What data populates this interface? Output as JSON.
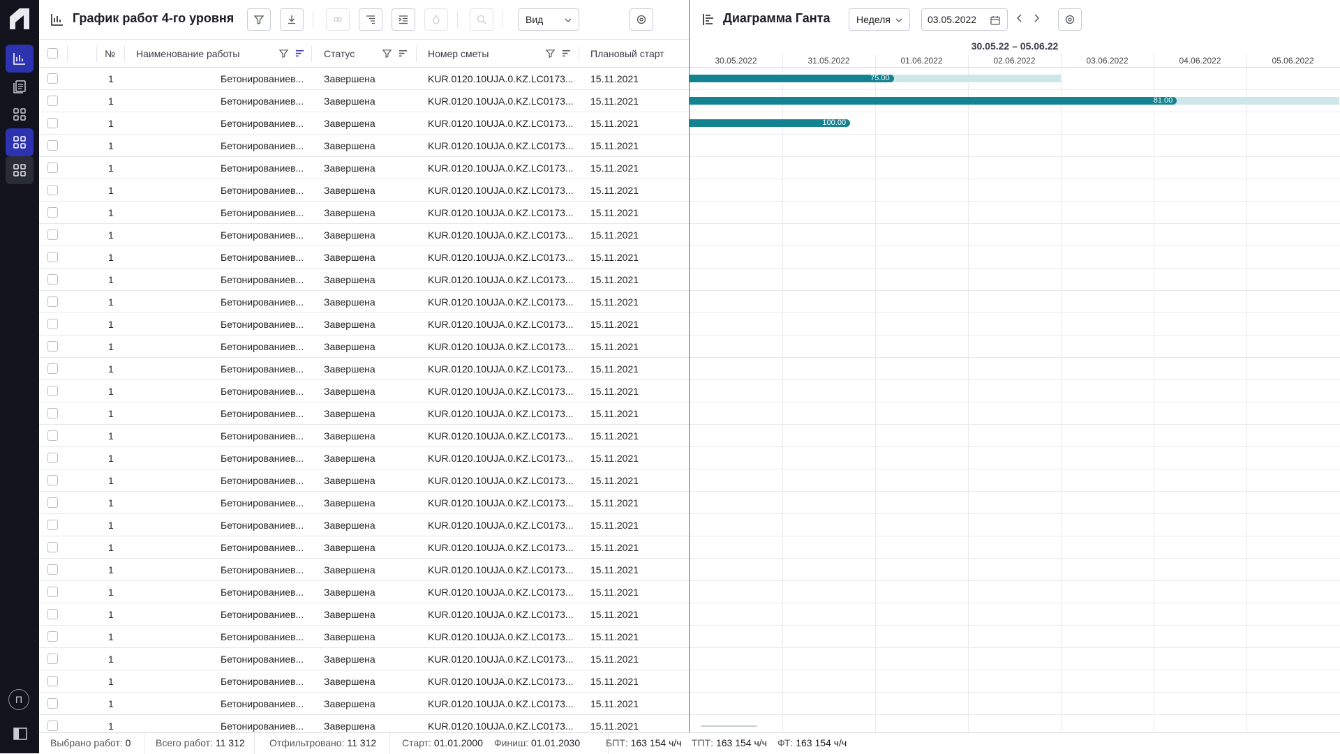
{
  "nav": {
    "items": [
      {
        "icon": "chart-icon",
        "state": "active"
      },
      {
        "icon": "documents-icon",
        "state": "normal"
      },
      {
        "icon": "grid-icon",
        "state": "normal"
      },
      {
        "icon": "grid-icon",
        "state": "active"
      },
      {
        "icon": "grid-icon",
        "state": "hover"
      }
    ],
    "user_initial": "П"
  },
  "left": {
    "title": "График работ 4-го уровня",
    "view_label": "Вид",
    "toolbar_icons": [
      "filter-icon",
      "download-icon",
      "link-icon",
      "indent-icon",
      "expand-icon",
      "fill-icon",
      "search-icon",
      "settings-icon"
    ],
    "columns": {
      "no": "№",
      "name": "Наименование работы",
      "status": "Статус",
      "smeta": "Номер сметы",
      "start": "Плановый старт"
    },
    "row_template": {
      "no": "1",
      "name": "Бетонированиев...",
      "status": "Завершена",
      "smeta": "KUR.0120.10UJA.0.KZ.LC0173...",
      "start": "15.11.2021"
    },
    "rows": [
      {
        "no": "1",
        "name": "Бетонированиев...",
        "status": "Завершена",
        "smeta": "KUR.0120.10UJA.0.KZ.LC0173...",
        "start": "15.11.2021"
      },
      {
        "no": "1",
        "name": "Бетонированиев...",
        "status": "Завершена",
        "smeta": "KUR.0120.10UJA.0.KZ.LC0173...",
        "start": "15.11.2021"
      },
      {
        "no": "1",
        "name": "Бетонированиев...",
        "status": "Завершена",
        "smeta": "KUR.0120.10UJA.0.KZ.LC0173...",
        "start": "15.11.2021"
      },
      {
        "no": "1",
        "name": "Бетонированиев...",
        "status": "Завершена",
        "smeta": "KUR.0120.10UJA.0.KZ.LC0173...",
        "start": "15.11.2021"
      },
      {
        "no": "1",
        "name": "Бетонированиев...",
        "status": "Завершена",
        "smeta": "KUR.0120.10UJA.0.KZ.LC0173...",
        "start": "15.11.2021"
      },
      {
        "no": "1",
        "name": "Бетонированиев...",
        "status": "Завершена",
        "smeta": "KUR.0120.10UJA.0.KZ.LC0173...",
        "start": "15.11.2021"
      },
      {
        "no": "1",
        "name": "Бетонированиев...",
        "status": "Завершена",
        "smeta": "KUR.0120.10UJA.0.KZ.LC0173...",
        "start": "15.11.2021"
      },
      {
        "no": "1",
        "name": "Бетонированиев...",
        "status": "Завершена",
        "smeta": "KUR.0120.10UJA.0.KZ.LC0173...",
        "start": "15.11.2021"
      },
      {
        "no": "1",
        "name": "Бетонированиев...",
        "status": "Завершена",
        "smeta": "KUR.0120.10UJA.0.KZ.LC0173...",
        "start": "15.11.2021"
      },
      {
        "no": "1",
        "name": "Бетонированиев...",
        "status": "Завершена",
        "smeta": "KUR.0120.10UJA.0.KZ.LC0173...",
        "start": "15.11.2021"
      },
      {
        "no": "1",
        "name": "Бетонированиев...",
        "status": "Завершена",
        "smeta": "KUR.0120.10UJA.0.KZ.LC0173...",
        "start": "15.11.2021"
      },
      {
        "no": "1",
        "name": "Бетонированиев...",
        "status": "Завершена",
        "smeta": "KUR.0120.10UJA.0.KZ.LC0173...",
        "start": "15.11.2021"
      },
      {
        "no": "1",
        "name": "Бетонированиев...",
        "status": "Завершена",
        "smeta": "KUR.0120.10UJA.0.KZ.LC0173...",
        "start": "15.11.2021"
      },
      {
        "no": "1",
        "name": "Бетонированиев...",
        "status": "Завершена",
        "smeta": "KUR.0120.10UJA.0.KZ.LC0173...",
        "start": "15.11.2021"
      },
      {
        "no": "1",
        "name": "Бетонированиев...",
        "status": "Завершена",
        "smeta": "KUR.0120.10UJA.0.KZ.LC0173...",
        "start": "15.11.2021"
      },
      {
        "no": "1",
        "name": "Бетонированиев...",
        "status": "Завершена",
        "smeta": "KUR.0120.10UJA.0.KZ.LC0173...",
        "start": "15.11.2021"
      },
      {
        "no": "1",
        "name": "Бетонированиев...",
        "status": "Завершена",
        "smeta": "KUR.0120.10UJA.0.KZ.LC0173...",
        "start": "15.11.2021"
      },
      {
        "no": "1",
        "name": "Бетонированиев...",
        "status": "Завершена",
        "smeta": "KUR.0120.10UJA.0.KZ.LC0173...",
        "start": "15.11.2021"
      },
      {
        "no": "1",
        "name": "Бетонированиев...",
        "status": "Завершена",
        "smeta": "KUR.0120.10UJA.0.KZ.LC0173...",
        "start": "15.11.2021"
      },
      {
        "no": "1",
        "name": "Бетонированиев...",
        "status": "Завершена",
        "smeta": "KUR.0120.10UJA.0.KZ.LC0173...",
        "start": "15.11.2021"
      },
      {
        "no": "1",
        "name": "Бетонированиев...",
        "status": "Завершена",
        "smeta": "KUR.0120.10UJA.0.KZ.LC0173...",
        "start": "15.11.2021"
      },
      {
        "no": "1",
        "name": "Бетонированиев...",
        "status": "Завершена",
        "smeta": "KUR.0120.10UJA.0.KZ.LC0173...",
        "start": "15.11.2021"
      },
      {
        "no": "1",
        "name": "Бетонированиев...",
        "status": "Завершена",
        "smeta": "KUR.0120.10UJA.0.KZ.LC0173...",
        "start": "15.11.2021"
      },
      {
        "no": "1",
        "name": "Бетонированиев...",
        "status": "Завершена",
        "smeta": "KUR.0120.10UJA.0.KZ.LC0173...",
        "start": "15.11.2021"
      },
      {
        "no": "1",
        "name": "Бетонированиев...",
        "status": "Завершена",
        "smeta": "KUR.0120.10UJA.0.KZ.LC0173...",
        "start": "15.11.2021"
      },
      {
        "no": "1",
        "name": "Бетонированиев...",
        "status": "Завершена",
        "smeta": "KUR.0120.10UJA.0.KZ.LC0173...",
        "start": "15.11.2021"
      },
      {
        "no": "1",
        "name": "Бетонированиев...",
        "status": "Завершена",
        "smeta": "KUR.0120.10UJA.0.KZ.LC0173...",
        "start": "15.11.2021"
      },
      {
        "no": "1",
        "name": "Бетонированиев...",
        "status": "Завершена",
        "smeta": "KUR.0120.10UJA.0.KZ.LC0173...",
        "start": "15.11.2021"
      },
      {
        "no": "1",
        "name": "Бетонированиев...",
        "status": "Завершена",
        "smeta": "KUR.0120.10UJA.0.KZ.LC0173...",
        "start": "15.11.2021"
      },
      {
        "no": "1",
        "name": "Бетонированиев...",
        "status": "Завершена",
        "smeta": "KUR.0120.10UJA.0.KZ.LC0173...",
        "start": "15.11.2021"
      }
    ]
  },
  "gantt": {
    "title": "Диаграмма Ганта",
    "scale_label": "Неделя",
    "date_value": "03.05.2022",
    "range_label": "30.05.22 – 05.06.22",
    "days": [
      "30.05.2022",
      "31.05.2022",
      "01.06.2022",
      "02.06.2022",
      "03.06.2022",
      "04.06.2022",
      "05.06.2022"
    ],
    "colors": {
      "bar": "#138391",
      "bar_bg": "#cde6ea",
      "accent": "#2d33b0",
      "nav_bg": "#12131c"
    },
    "bars": [
      {
        "row": 0,
        "label": "75.00",
        "progress_end_day": 2.2,
        "total_end_day": 4.0
      },
      {
        "row": 1,
        "label": "81.00",
        "progress_end_day": 5.25,
        "total_end_day": 7.0
      },
      {
        "row": 2,
        "label": "100.00",
        "progress_end_day": 1.73,
        "total_end_day": 1.73
      }
    ]
  },
  "status": {
    "selected_label": "Выбрано работ:",
    "selected_value": "0",
    "total_label": "Всего работ:",
    "total_value": "11 312",
    "filtered_label": "Отфильтровано:",
    "filtered_value": "11 312",
    "start_label": "Старт:",
    "start_value": "01.01.2000",
    "finish_label": "Финиш:",
    "finish_value": "01.01.2030",
    "bpt_label": "БПТ:",
    "bpt_value": "163 154 ч/ч",
    "tpt_label": "ТПТ:",
    "tpt_value": "163 154 ч/ч",
    "ft_label": "ФТ:",
    "ft_value": "163 154 ч/ч"
  }
}
